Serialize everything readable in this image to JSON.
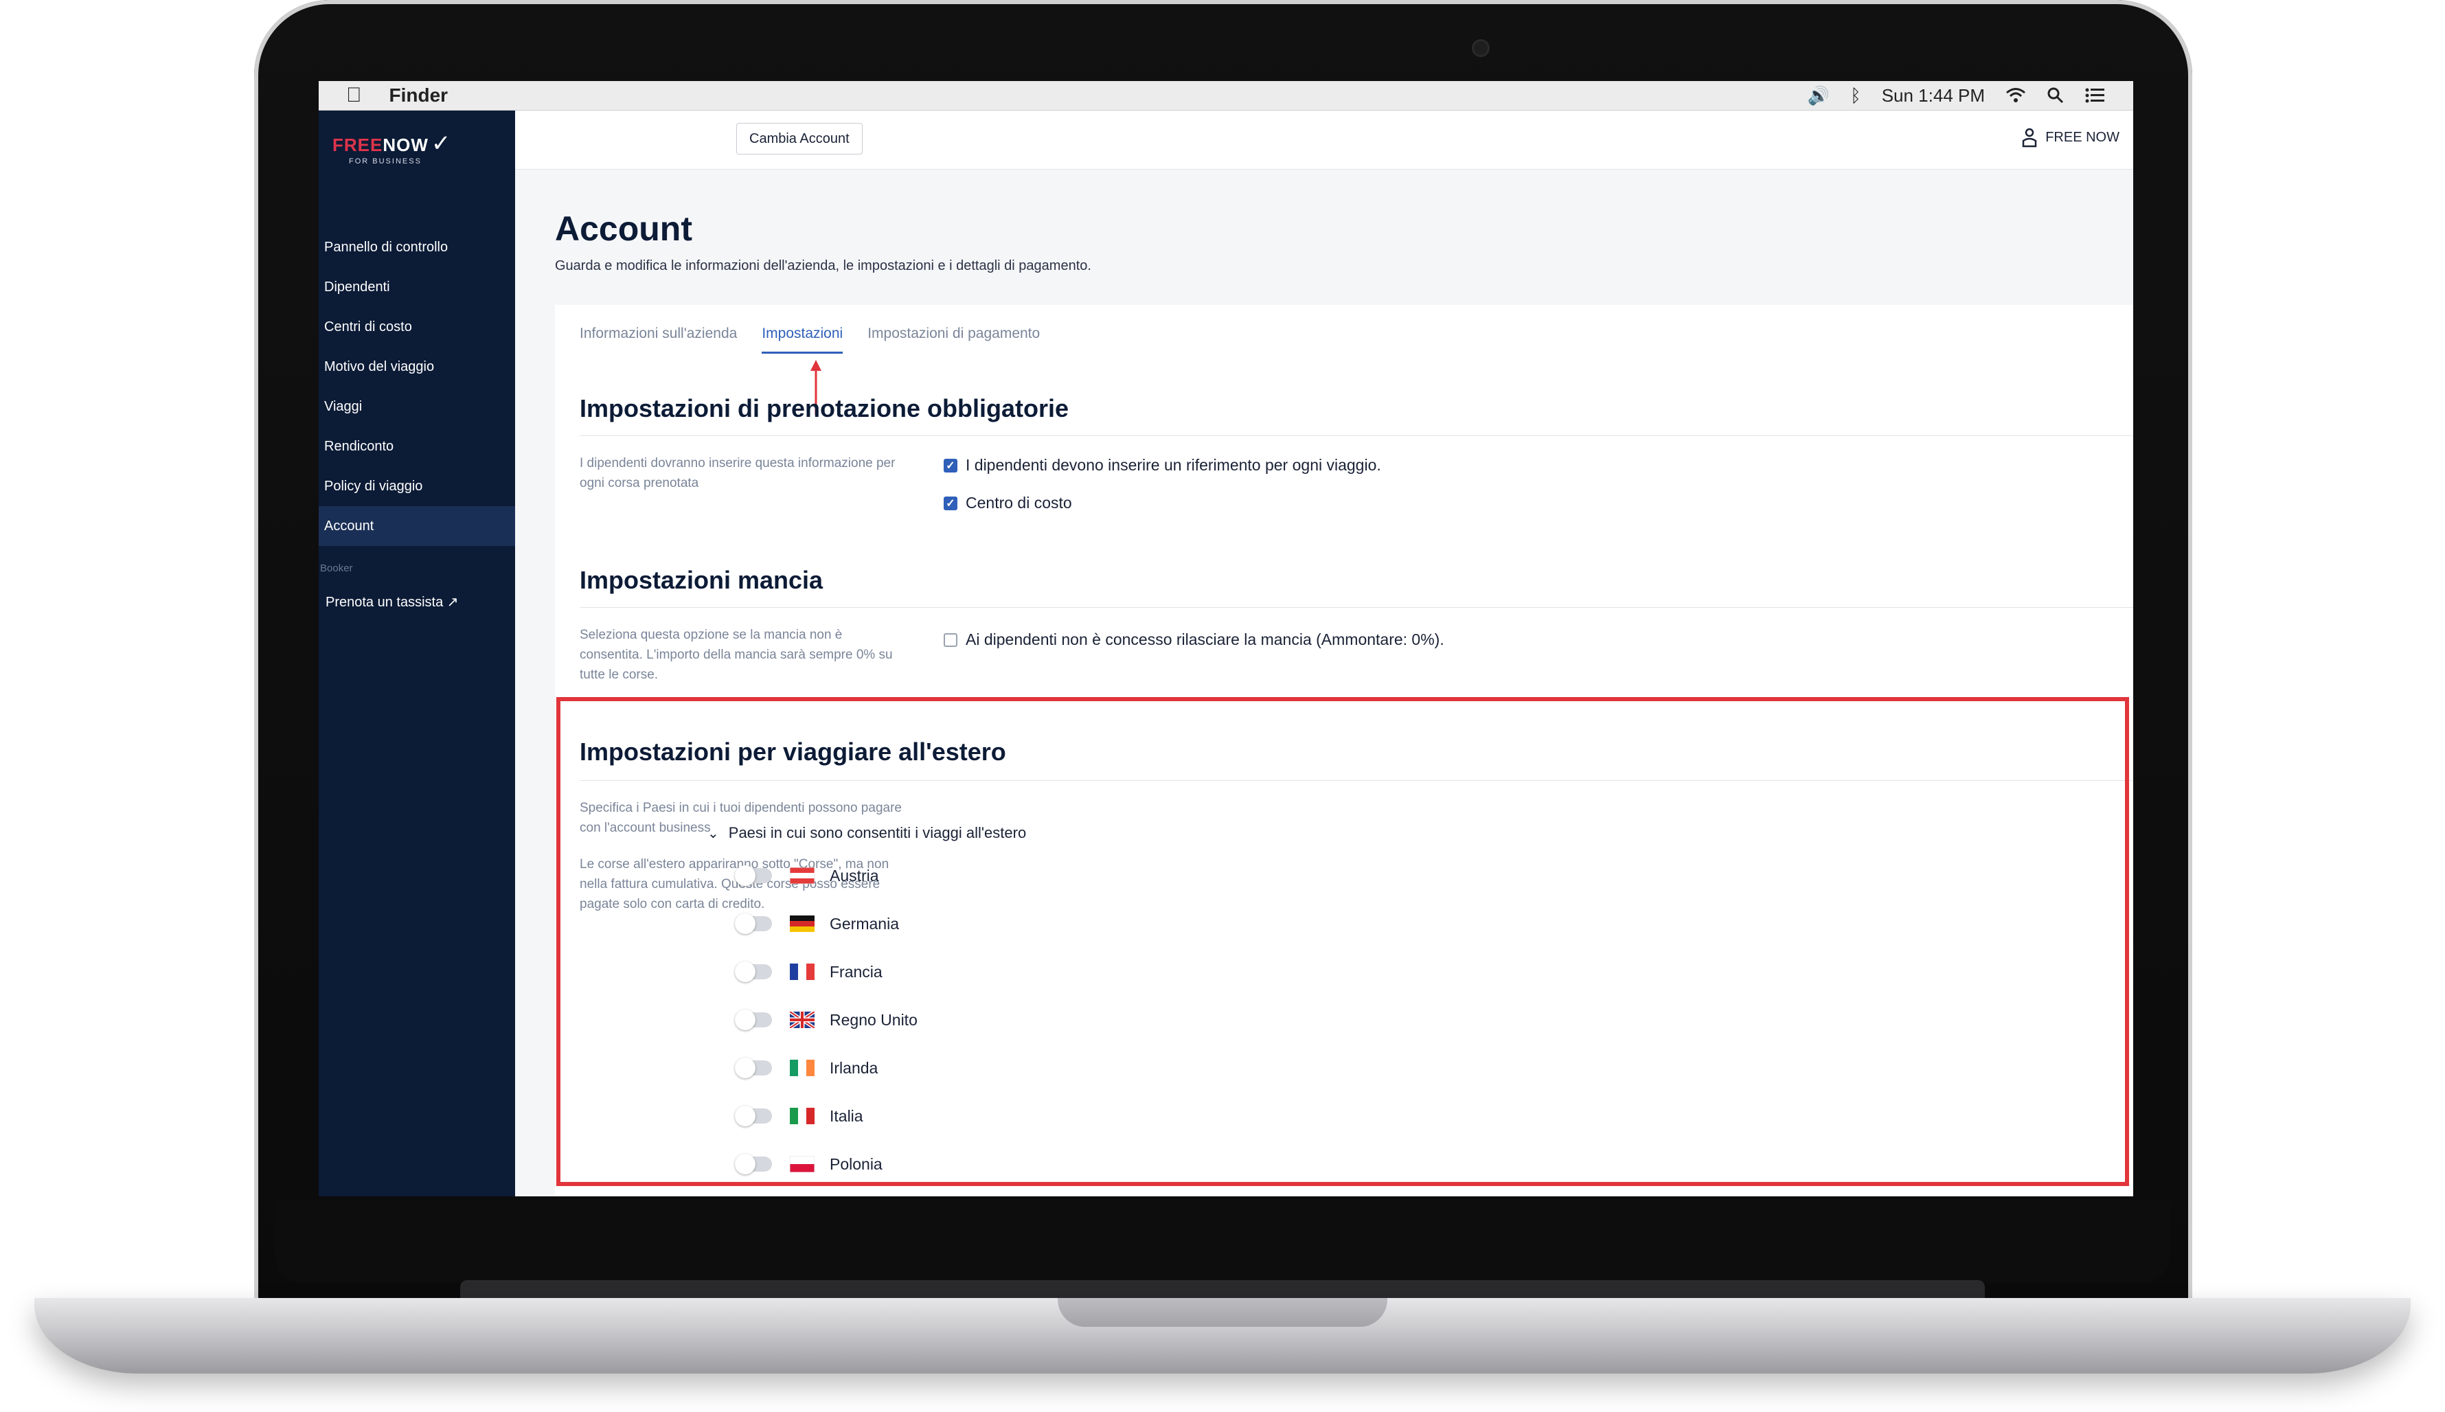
{
  "menubar": {
    "app_name": "Finder",
    "clock": "Sun 1:44 PM"
  },
  "sidebar": {
    "logo": {
      "brand_free": "FREE",
      "brand_now": "NOW",
      "sub": "FOR BUSINESS"
    },
    "items": [
      {
        "label": "Pannello di controllo"
      },
      {
        "label": "Dipendenti"
      },
      {
        "label": "Centri di costo"
      },
      {
        "label": "Motivo del viaggio"
      },
      {
        "label": "Viaggi"
      },
      {
        "label": "Rendiconto"
      },
      {
        "label": "Policy di viaggio"
      },
      {
        "label": "Account",
        "active": true
      }
    ],
    "section_label": "Booker",
    "booker_link": "Prenota un tassista ↗"
  },
  "header": {
    "switch_account": "Cambia Account",
    "user": "FREE NOW"
  },
  "page": {
    "title": "Account",
    "subtitle": "Guarda e modifica le informazioni dell'azienda, le impostazioni e i dettagli di pagamento."
  },
  "tabs": [
    {
      "label": "Informazioni sull'azienda"
    },
    {
      "label": "Impostazioni",
      "active": true
    },
    {
      "label": "Impostazioni di pagamento"
    }
  ],
  "sections": {
    "mandatory": {
      "title": "Impostazioni di prenotazione obbligatorie",
      "desc": "I dipendenti dovranno inserire questa informazione per ogni corsa prenotata",
      "options": [
        {
          "label": "I dipendenti devono inserire un riferimento per ogni viaggio.",
          "checked": true
        },
        {
          "label": "Centro di costo",
          "checked": true
        }
      ]
    },
    "tip": {
      "title": "Impostazioni mancia",
      "desc": "Seleziona questa opzione se la mancia non è consentita. L'importo della mancia sarà sempre 0% su tutte le corse.",
      "option": {
        "label": "Ai dipendenti non è concesso rilasciare la mancia (Ammontare: 0%).",
        "checked": false
      }
    },
    "abroad": {
      "title": "Impostazioni per viaggiare all'estero",
      "desc1": "Specifica i Paesi in cui i tuoi dipendenti possono pagare con l'account business",
      "desc2": "Le corse all'estero appariranno sotto \"Corse\", ma non nella fattura cumulativa. Queste corse posso essere pagate solo con carta di credito.",
      "countries_header": "Paesi in cui sono consentiti i viaggi all'estero",
      "countries": [
        {
          "name": "Austria",
          "enabled": false
        },
        {
          "name": "Germania",
          "enabled": false
        },
        {
          "name": "Francia",
          "enabled": false
        },
        {
          "name": "Regno Unito",
          "enabled": false
        },
        {
          "name": "Irlanda",
          "enabled": false
        },
        {
          "name": "Italia",
          "enabled": false
        },
        {
          "name": "Polonia",
          "enabled": false
        }
      ]
    }
  },
  "colors": {
    "sidebar_bg": "#0c1b36",
    "accent": "#2f5fb8",
    "highlight": "#e0353b",
    "brand_red": "#e0344a"
  }
}
